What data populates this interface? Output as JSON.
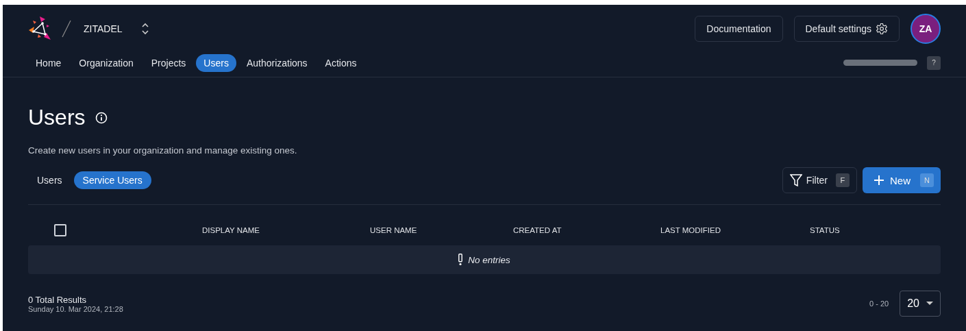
{
  "header": {
    "org_name": "ZITADEL",
    "buttons": [
      "Documentation",
      "Default settings"
    ],
    "avatar": "ZA",
    "help_badge": "?"
  },
  "nav": [
    {
      "label": "Home",
      "selected": false
    },
    {
      "label": "Organization",
      "selected": false
    },
    {
      "label": "Projects",
      "selected": false
    },
    {
      "label": "Users",
      "selected": true
    },
    {
      "label": "Authorizations",
      "selected": false
    },
    {
      "label": "Actions",
      "selected": false
    }
  ],
  "page": {
    "title": "Users",
    "description": "Create new users in your organization and manage existing ones."
  },
  "tabs": [
    {
      "label": "Users",
      "selected": false
    },
    {
      "label": "Service Users",
      "selected": true
    }
  ],
  "actions": {
    "filter": {
      "label": "Filter",
      "shortcut": "F"
    },
    "new": {
      "label": "New",
      "shortcut": "N"
    }
  },
  "table": {
    "select_all_checked": false,
    "columns": [
      "DISPLAY NAME",
      "USER NAME",
      "CREATED AT",
      "LAST MODIFIED",
      "STATUS"
    ],
    "empty_message": "No entries"
  },
  "footer": {
    "total": "0 Total Results",
    "timestamp": "Sunday 10. Mar 2024, 21:28",
    "range": "0 - 20",
    "page_size": "20"
  }
}
